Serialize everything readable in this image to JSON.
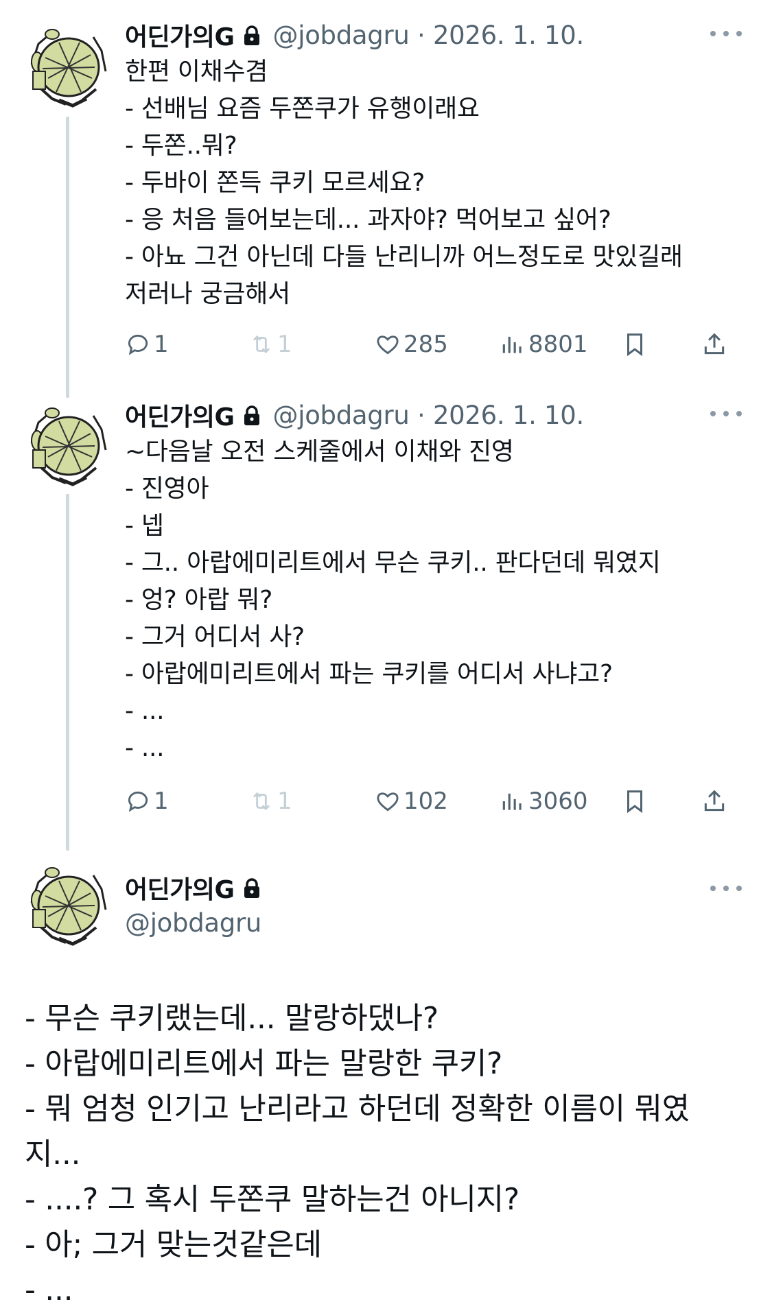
{
  "tweets": [
    {
      "name": "어딘가의G",
      "handle": "@jobdagru",
      "date": "2026. 1. 10.",
      "text": "한편 이채수겸\n- 선배님 요즘 두쫀쿠가 유행이래요\n- 두쫀..뭐?\n- 두바이 쫀득 쿠키 모르세요?\n- 응 처음 들어보는데... 과자야? 먹어보고 싶어?\n- 아뇨 그건 아닌데 다들 난리니까 어느정도로 맛있길래\n저러나 궁금해서",
      "replies": "1",
      "retweets": "1",
      "likes": "285",
      "views": "8801"
    },
    {
      "name": "어딘가의G",
      "handle": "@jobdagru",
      "date": "2026. 1. 10.",
      "text": "~다음날 오전 스케줄에서 이채와 진영\n- 진영아\n- 넵\n- 그.. 아랍에미리트에서 무슨 쿠키.. 판다던데 뭐였지\n- 엉? 아랍 뭐?\n- 그거 어디서 사?\n- 아랍에미리트에서 파는 쿠키를 어디서 사냐고?\n- ...\n- ...",
      "replies": "1",
      "retweets": "1",
      "likes": "102",
      "views": "3060"
    }
  ],
  "main_tweet": {
    "name": "어딘가의G",
    "handle": "@jobdagru",
    "text": "- 무슨 쿠키랬는데... 말랑하댔나?\n- 아랍에미리트에서 파는 말랑한 쿠키?\n- 뭐 엄청 인기고 난리라고 하던데 정확한 이름이 뭐였\n지...\n- ....? 그 혹시 두쫀쿠 말하는건 아니지?\n- 아; 그거 맞는것같은데\n- ..."
  },
  "icons": {
    "reply": "reply-icon",
    "retweet": "retweet-icon",
    "like": "heart-icon",
    "views": "views-icon",
    "bookmark": "bookmark-icon",
    "share": "share-icon",
    "lock": "lock-icon",
    "more": "more-icon"
  },
  "colors": {
    "text": "#0f1419",
    "secondary": "#536471",
    "thread_line": "#cfd9de",
    "avatar_shell": "#d3dca0"
  }
}
